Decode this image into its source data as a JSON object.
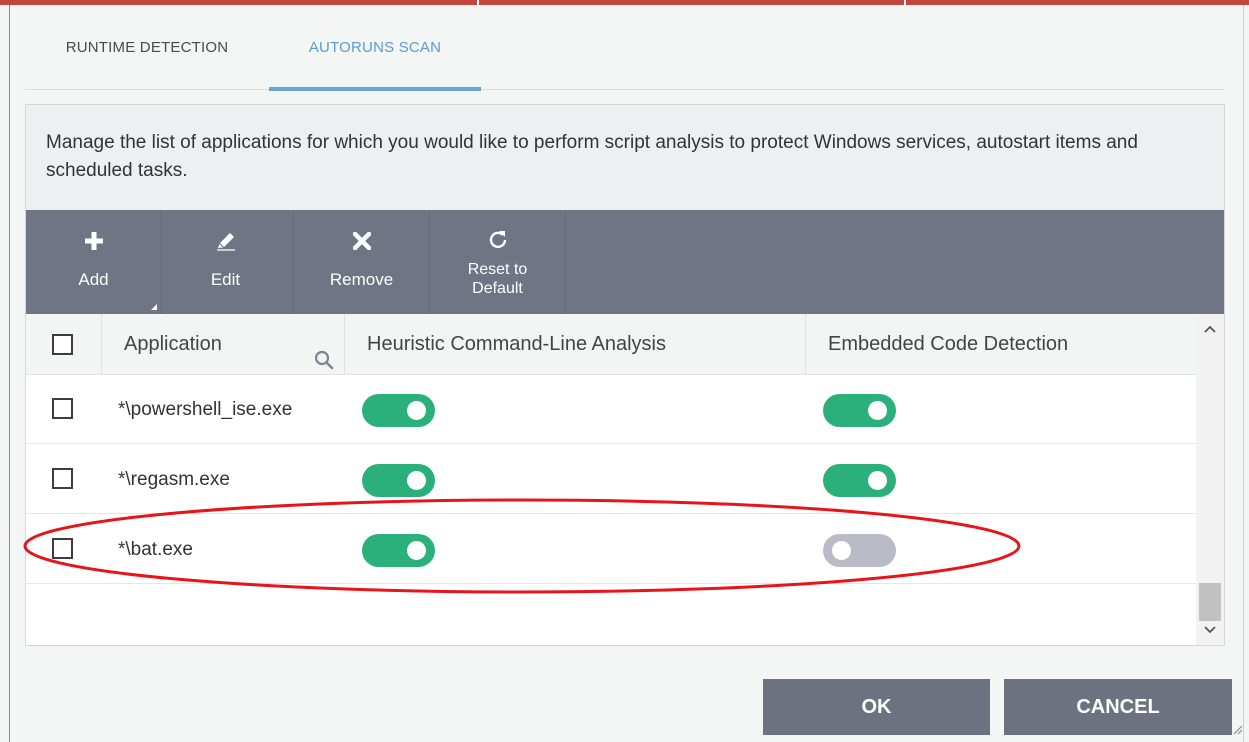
{
  "tabs": [
    {
      "label": "RUNTIME DETECTION",
      "active": false
    },
    {
      "label": "AUTORUNS SCAN",
      "active": true
    }
  ],
  "description": "Manage the list of applications for which you would like to perform script analysis to protect Windows services, autostart items and scheduled tasks.",
  "toolbar": {
    "add": {
      "label": "Add",
      "icon": "plus-icon"
    },
    "edit": {
      "label": "Edit",
      "icon": "pencil-icon"
    },
    "remove": {
      "label": "Remove",
      "icon": "x-icon"
    },
    "reset": {
      "label_line1": "Reset to",
      "label_line2": "Default",
      "icon": "refresh-icon"
    }
  },
  "table": {
    "columns": {
      "application": "Application",
      "heuristic": "Heuristic Command-Line Analysis",
      "embedded": "Embedded Code Detection"
    },
    "rows": [
      {
        "application": "*\\powershell_ise.exe",
        "checked": false,
        "heuristic": true,
        "embedded": true
      },
      {
        "application": "*\\regasm.exe",
        "checked": false,
        "heuristic": true,
        "embedded": true
      },
      {
        "application": "*\\bat.exe",
        "checked": false,
        "heuristic": true,
        "embedded": false
      }
    ]
  },
  "buttons": {
    "ok": "OK",
    "cancel": "CANCEL"
  },
  "colors": {
    "toggle_on": "#2bb07c",
    "toggle_off": "#b9bcc7",
    "toolbar_bg": "#707585",
    "accent_tab": "#5a9bd3",
    "highlight": "#e8141b",
    "top_border": "#c4453d"
  }
}
